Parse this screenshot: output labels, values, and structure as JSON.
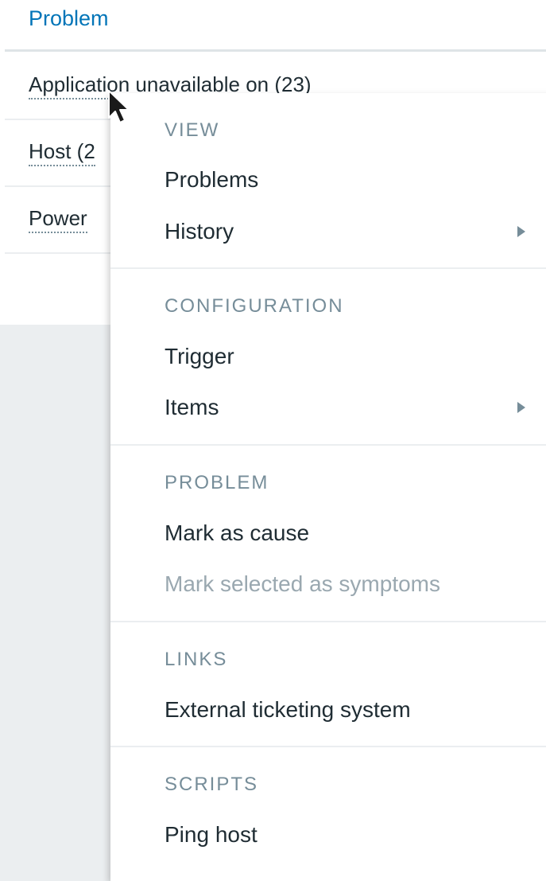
{
  "table": {
    "column_header": "Problem",
    "rows": [
      {
        "label": "Application unavailable on (23)"
      },
      {
        "label": "Host (2"
      },
      {
        "label": "Power"
      }
    ]
  },
  "context_menu": {
    "sections": [
      {
        "title": "VIEW",
        "items": [
          {
            "label": "Problems",
            "submenu": false,
            "disabled": false
          },
          {
            "label": "History",
            "submenu": true,
            "disabled": false
          }
        ]
      },
      {
        "title": "CONFIGURATION",
        "items": [
          {
            "label": "Trigger",
            "submenu": false,
            "disabled": false
          },
          {
            "label": "Items",
            "submenu": true,
            "disabled": false
          }
        ]
      },
      {
        "title": "PROBLEM",
        "items": [
          {
            "label": "Mark as cause",
            "submenu": false,
            "disabled": false
          },
          {
            "label": "Mark selected as symptoms",
            "submenu": false,
            "disabled": true
          }
        ]
      },
      {
        "title": "LINKS",
        "items": [
          {
            "label": "External ticketing system",
            "submenu": false,
            "disabled": false
          }
        ]
      },
      {
        "title": "SCRIPTS",
        "items": [
          {
            "label": "Ping host",
            "submenu": false,
            "disabled": false
          }
        ]
      }
    ]
  },
  "colors": {
    "link": "#0275b8",
    "text": "#1f2c33",
    "muted": "#768d99",
    "disabled": "#9aa8b0",
    "background": "#ebeef0"
  },
  "icons": {
    "cursor": "mouse-pointer-icon",
    "submenu": "submenu-arrow-icon"
  }
}
